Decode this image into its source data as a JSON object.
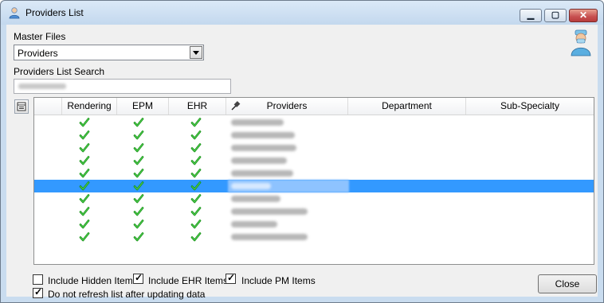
{
  "window": {
    "title": "Providers List"
  },
  "master_files": {
    "label": "Master Files",
    "value": "Providers"
  },
  "search": {
    "label": "Providers List Search",
    "value": ""
  },
  "grid": {
    "columns": [
      {
        "label": ""
      },
      {
        "label": "Rendering"
      },
      {
        "label": "EPM"
      },
      {
        "label": "EHR"
      },
      {
        "label": "Providers"
      },
      {
        "label": "Department"
      },
      {
        "label": "Sub-Specialty"
      }
    ],
    "selected_row": 5,
    "rows": [
      {
        "rendering": true,
        "epm": true,
        "ehr": true
      },
      {
        "rendering": true,
        "epm": true,
        "ehr": true
      },
      {
        "rendering": true,
        "epm": true,
        "ehr": true
      },
      {
        "rendering": true,
        "epm": true,
        "ehr": true
      },
      {
        "rendering": true,
        "epm": true,
        "ehr": true
      },
      {
        "rendering": true,
        "epm": true,
        "ehr": true
      },
      {
        "rendering": true,
        "epm": true,
        "ehr": true
      },
      {
        "rendering": true,
        "epm": true,
        "ehr": true
      },
      {
        "rendering": true,
        "epm": true,
        "ehr": true
      },
      {
        "rendering": true,
        "epm": true,
        "ehr": true
      }
    ]
  },
  "options": {
    "include_hidden": {
      "label": "Include Hidden Items",
      "checked": false
    },
    "include_ehr": {
      "label": "Include EHR Items",
      "checked": true
    },
    "include_pm": {
      "label": "Include PM Items",
      "checked": true
    },
    "no_refresh": {
      "label": "Do not refresh list after updating data",
      "checked": true
    }
  },
  "buttons": {
    "close": "Close"
  },
  "icons": {
    "title": "user-icon",
    "avatar": "doctor-avatar-icon",
    "column_chooser": "column-chooser-icon",
    "checkmark": "green-checkmark-icon"
  }
}
